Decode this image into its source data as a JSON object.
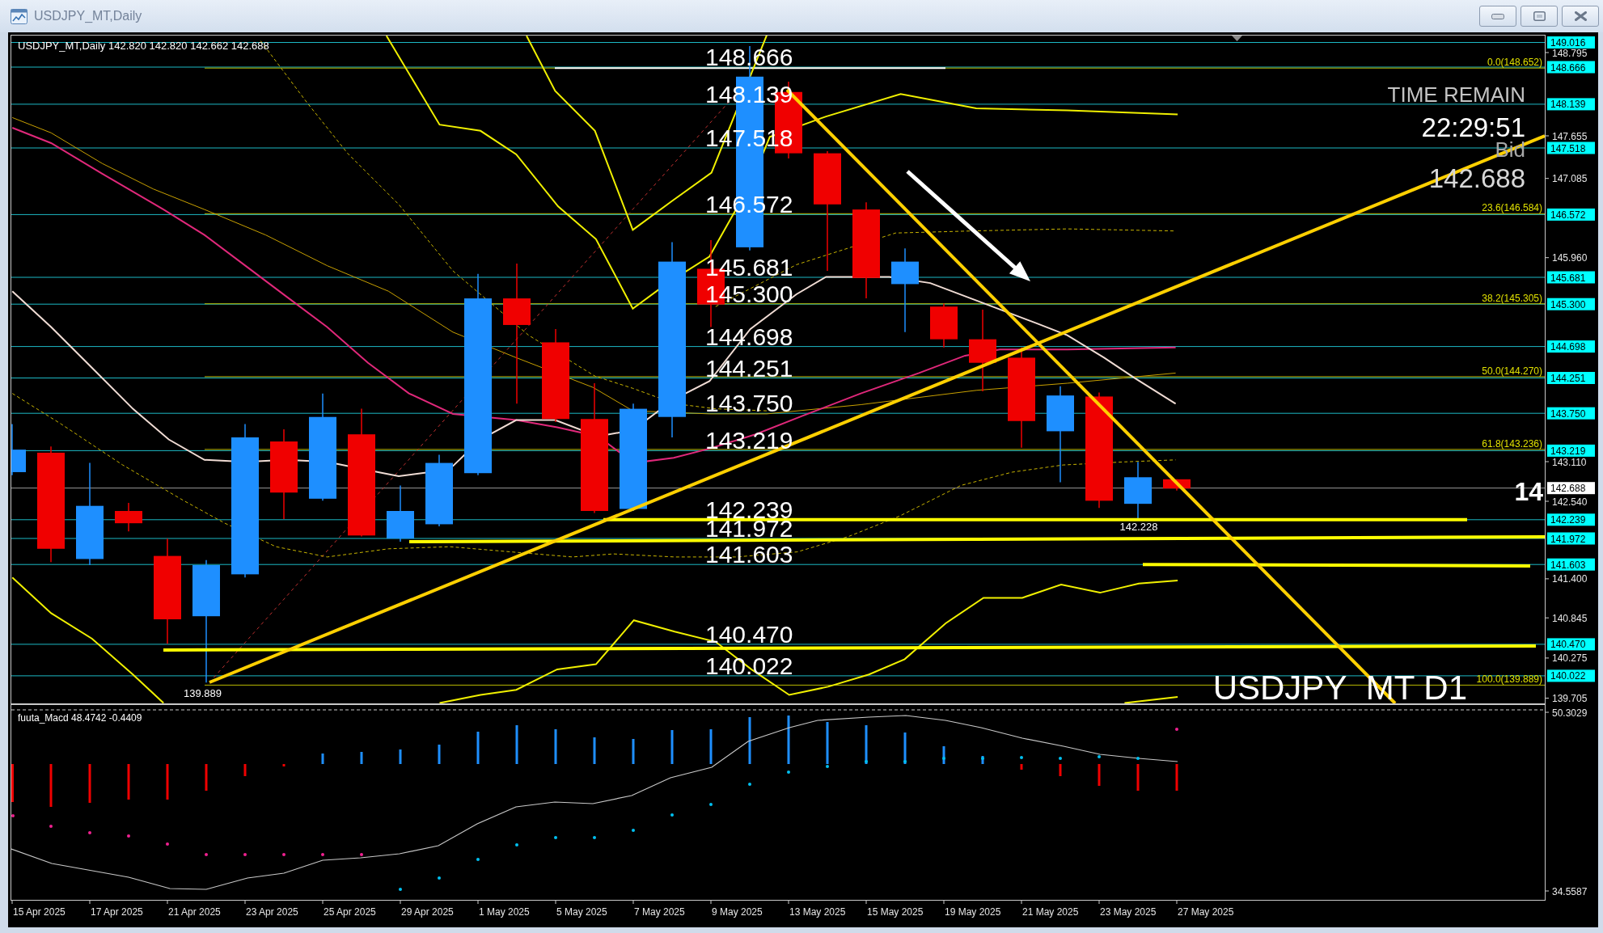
{
  "window": {
    "title": "USDJPY_MT,Daily"
  },
  "chart": {
    "header": "USDJPY_MT,Daily 142.820 142.820 142.662 142.688",
    "level_labels": [
      "148.666",
      "148.139",
      "147.518",
      "146.572",
      "145.681",
      "145.300",
      "144.698",
      "144.251",
      "143.750",
      "143.219",
      "142.239",
      "141.972",
      "141.603",
      "140.470",
      "140.022"
    ],
    "fibonacci_labels": [
      "0.0(148.652)",
      "23.6(146.584)",
      "38.2(145.305)",
      "50.0(144.270)",
      "61.8(143.236)",
      "100.0(139.889)"
    ],
    "low_label": "139.889",
    "close_low_label": "142.228",
    "edge_label": "14",
    "timer": {
      "label": "TIME REMAIN",
      "value": "22:29:51",
      "bid_label": "Bid",
      "bid_value": "142.688"
    },
    "symbol_label": "USDJPY_MT D1"
  },
  "price_axis": {
    "tags": [
      {
        "text": "149.016",
        "kind": "level"
      },
      {
        "text": "148.666",
        "kind": "level"
      },
      {
        "text": "148.139",
        "kind": "level"
      },
      {
        "text": "147.518",
        "kind": "level"
      },
      {
        "text": "146.572",
        "kind": "level"
      },
      {
        "text": "145.681",
        "kind": "level"
      },
      {
        "text": "145.300",
        "kind": "level"
      },
      {
        "text": "144.698",
        "kind": "level"
      },
      {
        "text": "144.251",
        "kind": "level"
      },
      {
        "text": "143.750",
        "kind": "level"
      },
      {
        "text": "143.219",
        "kind": "level"
      },
      {
        "text": "142.688",
        "kind": "bid"
      },
      {
        "text": "142.239",
        "kind": "level"
      },
      {
        "text": "141.972",
        "kind": "level"
      },
      {
        "text": "141.603",
        "kind": "level"
      },
      {
        "text": "140.470",
        "kind": "level"
      },
      {
        "text": "140.022",
        "kind": "level"
      }
    ],
    "ticks": [
      "148.795",
      "147.655",
      "147.085",
      "145.960",
      "143.110",
      "142.540",
      "141.400",
      "140.845",
      "140.275",
      "139.705"
    ]
  },
  "macd": {
    "header": "fuuta_Macd 48.4742 -0.4409",
    "axis_labels": [
      "50.3029",
      "34.5587"
    ]
  },
  "date_axis": [
    "15 Apr 2025",
    "17 Apr 2025",
    "21 Apr 2025",
    "23 Apr 2025",
    "25 Apr 2025",
    "29 Apr 2025",
    "1 May 2025",
    "5 May 2025",
    "7 May 2025",
    "9 May 2025",
    "13 May 2025",
    "15 May 2025",
    "19 May 2025",
    "21 May 2025",
    "23 May 2025",
    "27 May 2025"
  ]
}
